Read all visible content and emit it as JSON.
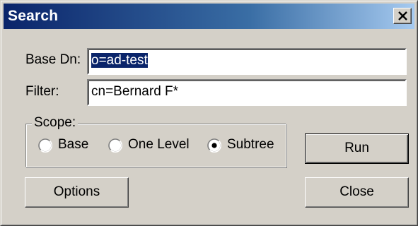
{
  "dialog": {
    "title": "Search"
  },
  "form": {
    "base_dn_label": "Base Dn:",
    "base_dn_value": "o=ad-test",
    "filter_label": "Filter:",
    "filter_value": "cn=Bernard F*"
  },
  "scope": {
    "label": "Scope:",
    "options": [
      {
        "label": "Base",
        "selected": false
      },
      {
        "label": "One Level",
        "selected": false
      },
      {
        "label": "Subtree",
        "selected": true
      }
    ]
  },
  "buttons": {
    "run_label": "Run",
    "options_label": "Options",
    "close_label": "Close"
  },
  "colors": {
    "dialog_face": "#d4d0c8",
    "title_bar_start": "#0a246a",
    "title_bar_end": "#a6caf0",
    "selection": "#0a246a"
  },
  "icons": {
    "close": "close-icon"
  }
}
